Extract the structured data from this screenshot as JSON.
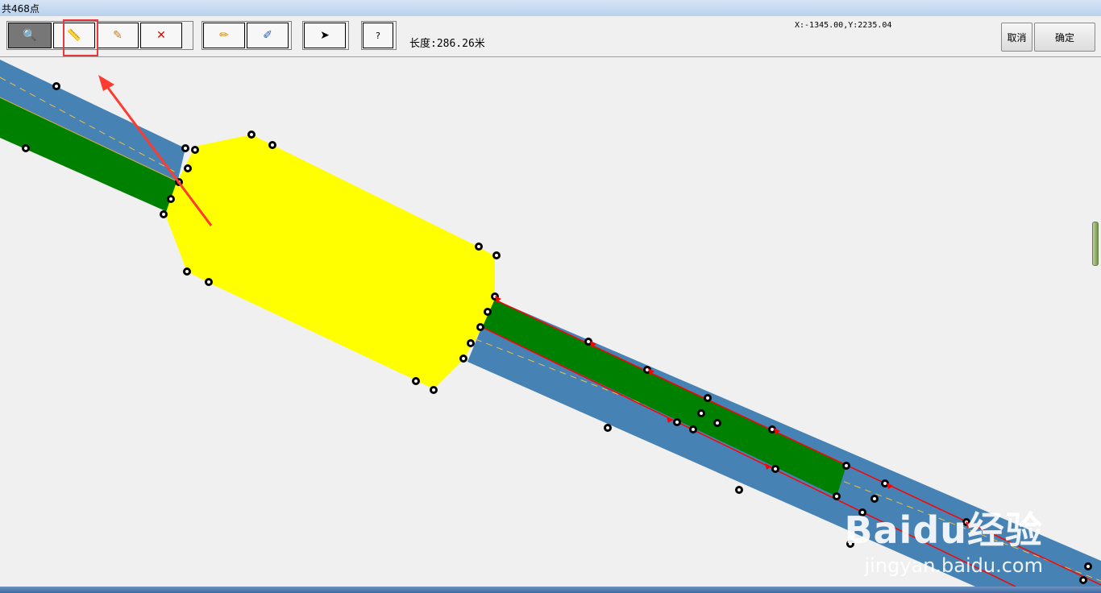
{
  "window": {
    "title": "共468点"
  },
  "toolbar": {
    "buttons": [
      {
        "name": "zoom-button",
        "icon": "magnifier-icon",
        "glyph": "🔍"
      },
      {
        "name": "measure-button",
        "icon": "ruler-icon",
        "glyph": "📏"
      },
      {
        "name": "eraser-button",
        "icon": "eraser-icon",
        "glyph": "✎"
      },
      {
        "name": "delete-button",
        "icon": "close-icon",
        "glyph": "✕"
      },
      {
        "name": "pencil-button",
        "icon": "pencil-icon",
        "glyph": "✏"
      },
      {
        "name": "edit-button",
        "icon": "edit-icon",
        "glyph": "✐"
      },
      {
        "name": "select-button",
        "icon": "cursor-icon",
        "glyph": "➤"
      },
      {
        "name": "help-button",
        "icon": "help-icon",
        "glyph": "?"
      }
    ],
    "length_label": "长度:286.26米",
    "coordinates": "X:-1345.00,Y:2235.04",
    "cancel_label": "取消",
    "ok_label": "确定"
  },
  "watermark": {
    "brand": "Baidu经验",
    "url": "jingyan.baidu.com"
  },
  "colors": {
    "road": "#4682b4",
    "lane": "#008000",
    "junction": "#ffff00",
    "highlight": "#ff0000"
  }
}
